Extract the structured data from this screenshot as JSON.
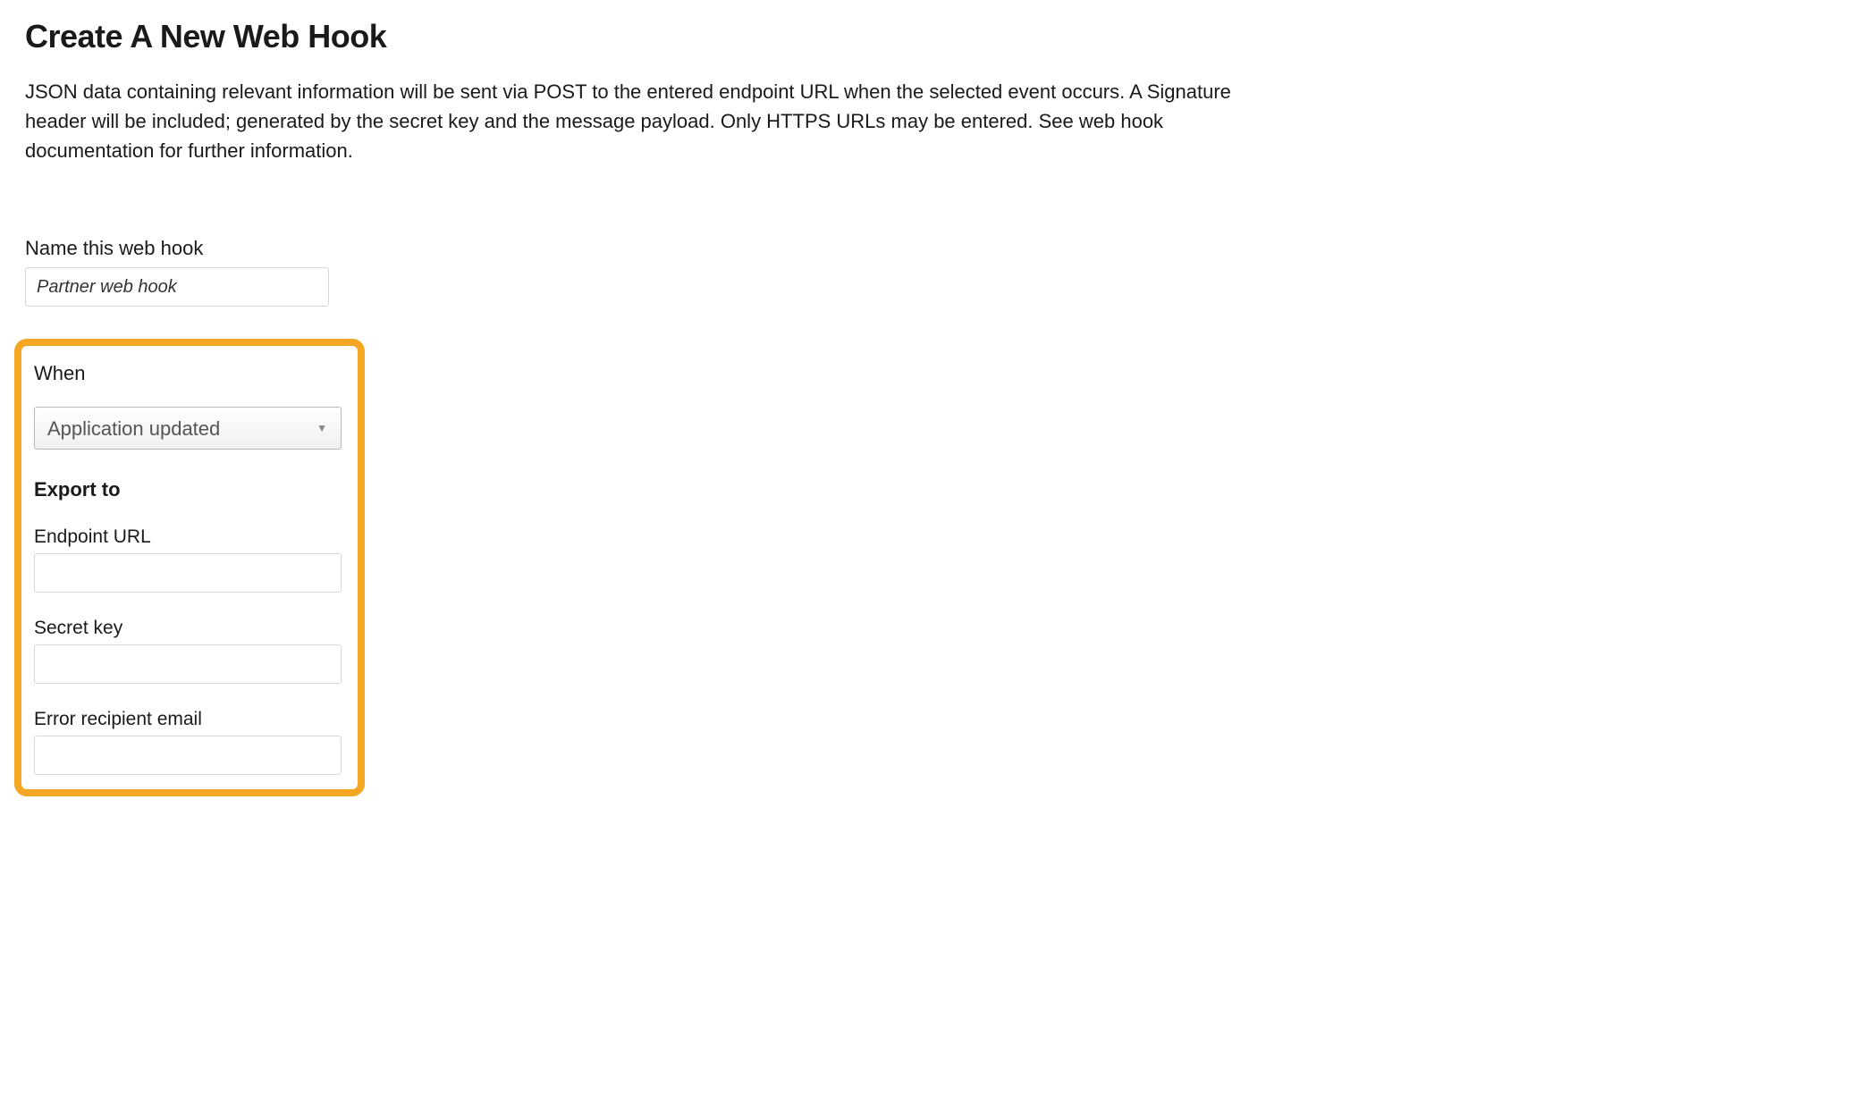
{
  "header": {
    "title": "Create A New Web Hook",
    "description": "JSON data containing relevant information will be sent via POST to the entered endpoint URL when the selected event occurs. A Signature header will be included; generated by the secret key and the message payload. Only HTTPS URLs may be entered. See web hook documentation for further information."
  },
  "form": {
    "name_label": "Name this web hook",
    "name_placeholder": "Partner web hook",
    "name_value": "",
    "when_label": "When",
    "when_selected": "Application updated",
    "export_to_label": "Export to",
    "endpoint_url_label": "Endpoint URL",
    "endpoint_url_value": "",
    "secret_key_label": "Secret key",
    "secret_key_value": "",
    "error_email_label": "Error recipient email",
    "error_email_value": ""
  }
}
